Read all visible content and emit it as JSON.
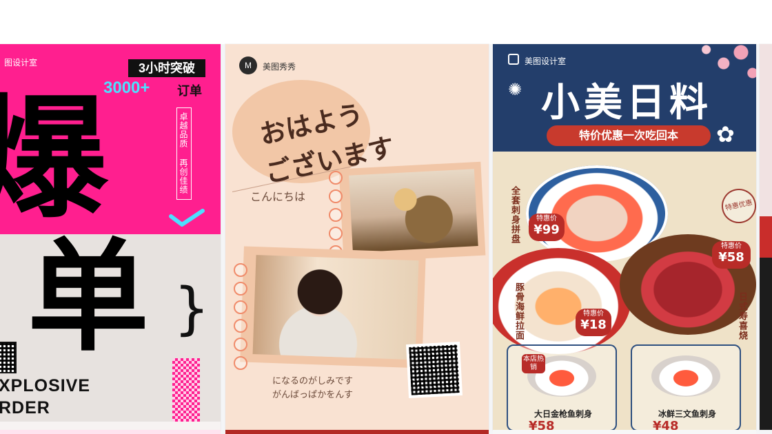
{
  "cards": [
    {
      "brand": "图设计室",
      "headline_box": "3小时突破",
      "number": "3000+",
      "number_suffix": "订单",
      "big_char_1": "爆",
      "big_char_2": "单",
      "vertical_tag": "卓越品质 再创佳绩",
      "english_line_1": "XPLOSIVE",
      "english_line_2": "RDER",
      "colors": {
        "bg": "#ff1f8f",
        "accent": "#4de0ff",
        "text": "#111111"
      }
    },
    {
      "brand_logo": "M",
      "brand": "美图秀秀",
      "title_line_1": "おはよう",
      "title_line_2": "ございます",
      "subtitle": "こんにちは",
      "footer_line_1": "になるのがしみです",
      "footer_line_2": "がんばっぱかをんす",
      "colors": {
        "bg": "#f9e2d2",
        "accent": "#f08b6a",
        "text": "#4a2b1f"
      }
    },
    {
      "brand": "美图设计室",
      "title": "小美日料",
      "ribbon": "特价优惠一次吃回本",
      "price_tag_label": "特惠价",
      "prices": [
        "¥99",
        "¥58",
        "¥18"
      ],
      "labels": [
        "全套刺身拼盘",
        "豚骨海鲜拉面",
        "日式寿喜烧"
      ],
      "stamp": "特惠优惠",
      "box_badge": "本店热销",
      "bottom_items": [
        {
          "name": "大日金枪鱼刺身",
          "price": "¥58"
        },
        {
          "name": "冰鲜三文鱼刺身",
          "price": "¥48"
        }
      ],
      "colors": {
        "top": "#233e6b",
        "bottom": "#efe2c8",
        "accent": "#b82c28"
      }
    }
  ],
  "icons": [
    "meitu-logo-icon",
    "design-lab-logo-icon",
    "checkmark-icon",
    "brace-icon",
    "qr-code-icon",
    "flower-icon"
  ]
}
